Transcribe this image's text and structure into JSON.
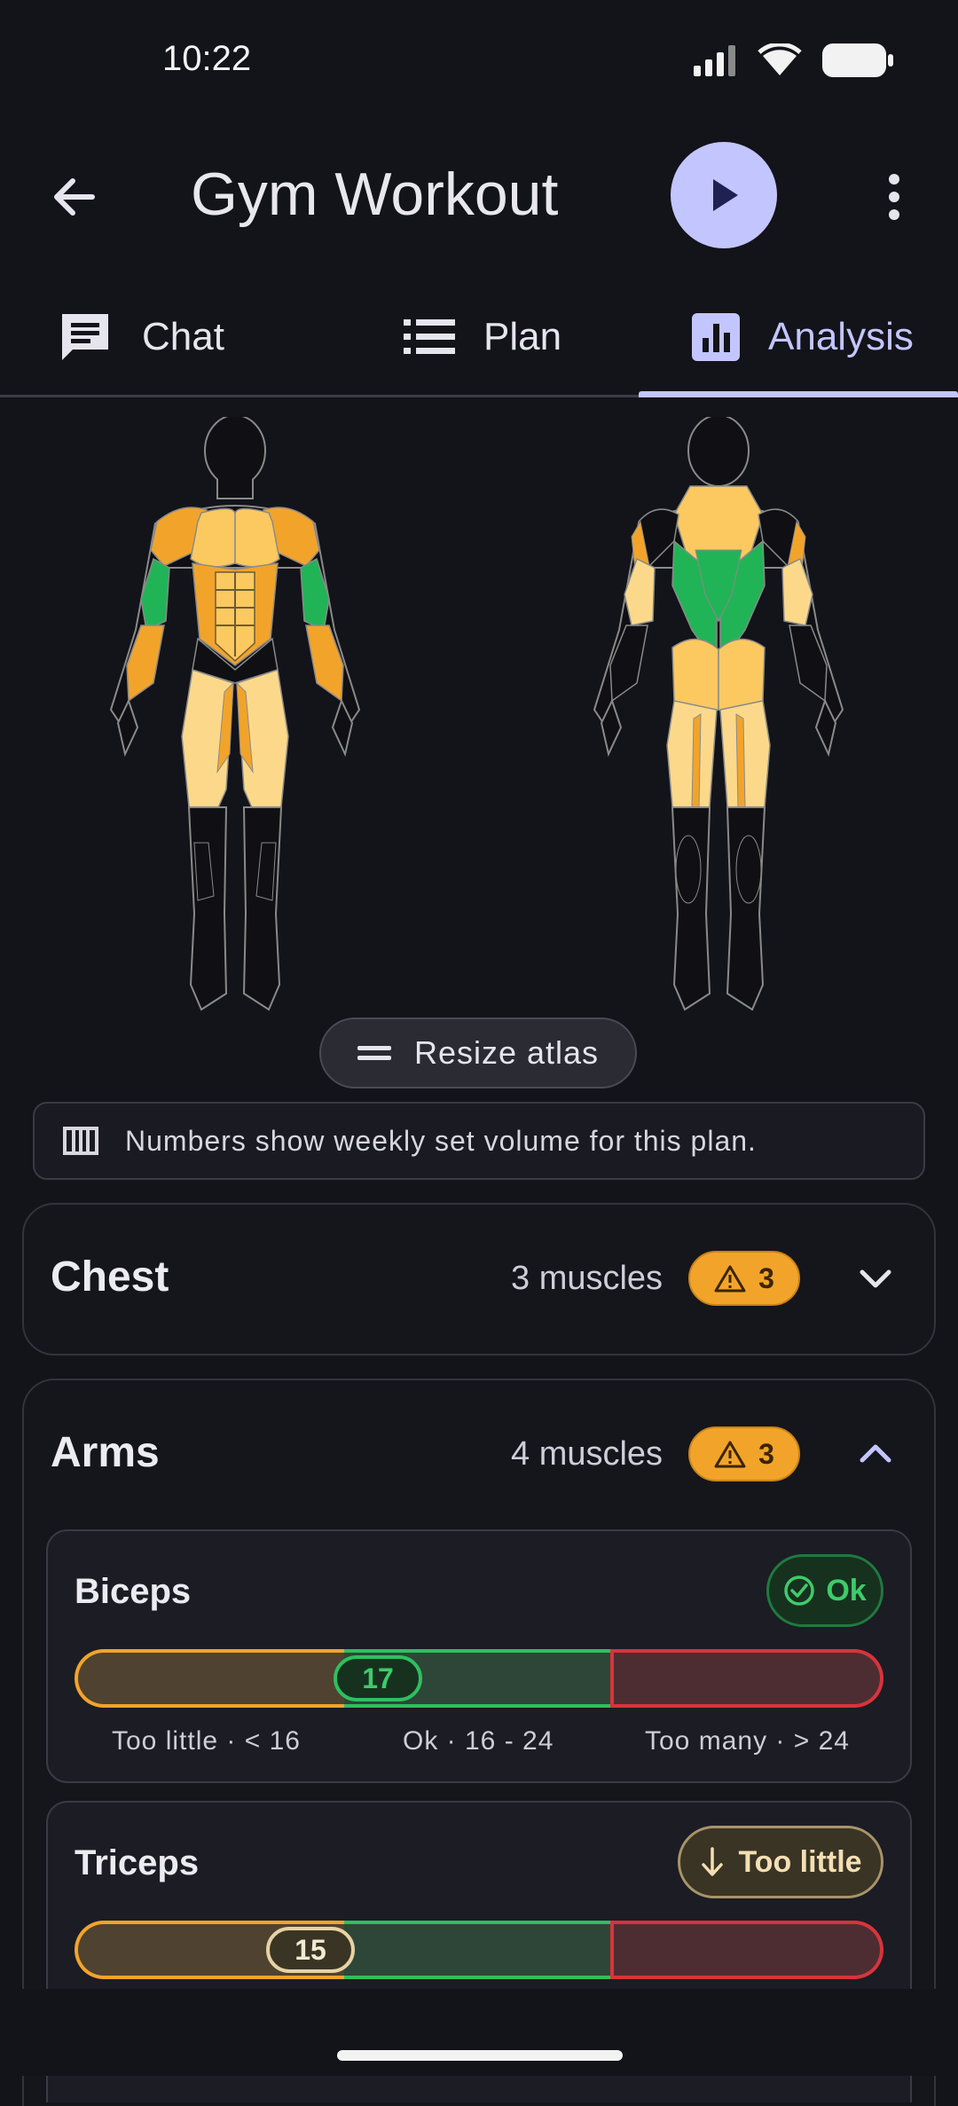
{
  "status_bar": {
    "time": "10:22"
  },
  "app_bar": {
    "title": "Gym Workout"
  },
  "tabs": [
    {
      "label": "Chat",
      "icon": "chat-icon"
    },
    {
      "label": "Plan",
      "icon": "list-icon"
    },
    {
      "label": "Analysis",
      "icon": "chart-icon",
      "selected": true
    }
  ],
  "atlas": {
    "resize_label": "Resize atlas",
    "info_text": "Numbers show weekly set volume for this plan."
  },
  "colors": {
    "accent": "#c3c5ff",
    "ok": "#2fbf5f",
    "too_little": "#f2a42a",
    "too_many": "#d8343c",
    "background": "#13131a"
  },
  "groups": [
    {
      "name": "Chest",
      "count_label": "3 muscles",
      "warning_count": "3",
      "expanded": false
    },
    {
      "name": "Arms",
      "count_label": "4 muscles",
      "warning_count": "3",
      "expanded": true
    }
  ],
  "muscles": [
    {
      "name": "Biceps",
      "status": "Ok",
      "value": "17",
      "value_num": 17,
      "labels": [
        "Too little · < 16",
        "Ok · 16 - 24",
        "Too many · > 24"
      ]
    },
    {
      "name": "Triceps",
      "status": "Too little",
      "value": "15",
      "value_num": 15
    }
  ]
}
